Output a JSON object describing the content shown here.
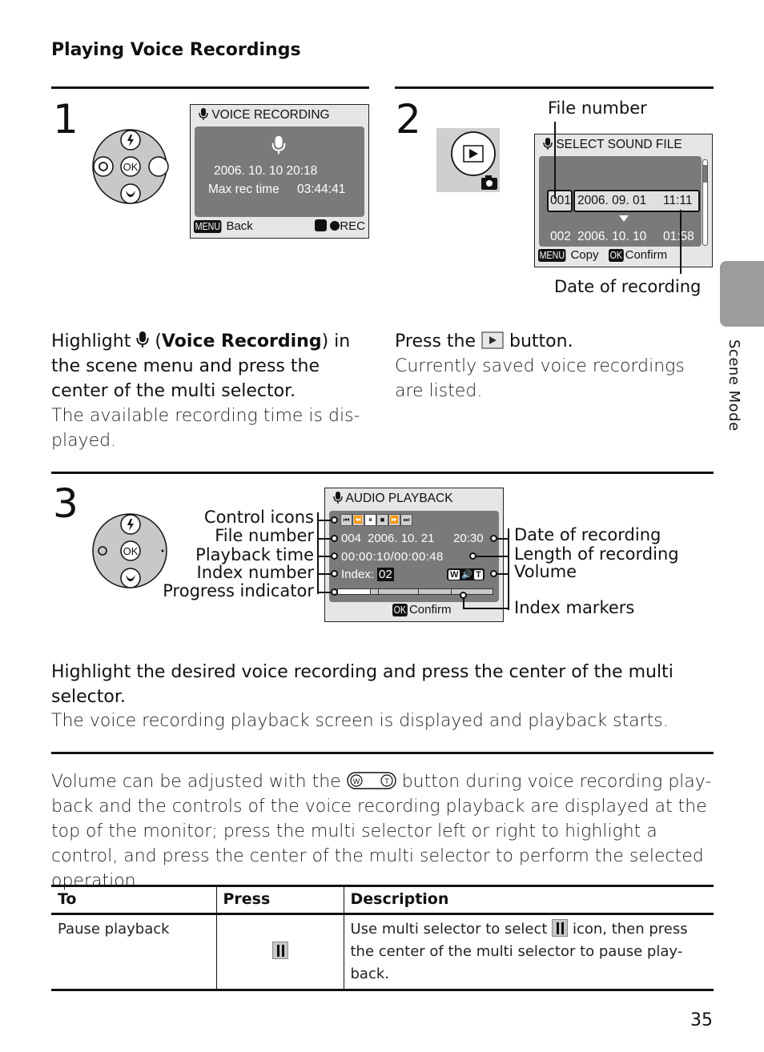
{
  "page": {
    "title": "Playing Voice Recordings",
    "page_number": "35",
    "side_tab_label": "Scene Mode"
  },
  "step1": {
    "number": "1",
    "screen": {
      "header": "VOICE RECORDING",
      "date_time": "2006. 10. 10   20:18",
      "max_rec_label": "Max rec time",
      "max_rec_value": "03:44:41",
      "menu_badge": "MENU",
      "back_label": "Back",
      "rec_label": "REC"
    },
    "instruction_pre": "Highlight",
    "instruction_bold": "Voice Recording",
    "instruction_post": ") in the scene menu and press the center of the multi selector.",
    "instruction_open_paren": "(",
    "description": "The available recording time is dis-played."
  },
  "step2": {
    "number": "2",
    "callout_file_number": "File number",
    "callout_date": "Date of recording",
    "screen": {
      "header": "SELECT SOUND FILE",
      "rows": [
        {
          "file": "001",
          "date": "2006. 09. 01",
          "time": "11:11",
          "selected": true
        },
        {
          "file": "002",
          "date": "2006. 10. 10",
          "time": "01:58",
          "selected": false
        }
      ],
      "menu_badge": "MENU",
      "copy_label": "Copy",
      "ok_badge": "OK",
      "confirm_label": "Confirm"
    },
    "instruction_pre": "Press the",
    "instruction_post": "button.",
    "description": "Currently saved voice recordings are listed."
  },
  "step3": {
    "number": "3",
    "screen": {
      "header": "AUDIO PLAYBACK",
      "controls": [
        "skip-back",
        "rewind",
        "pause",
        "stop",
        "fast-forward",
        "skip-forward"
      ],
      "selected_control": "pause",
      "file_number": "004",
      "date": "2006. 10. 21",
      "time": "20:30",
      "playback_time": "00:00:10/00:00:48",
      "index_label": "Index:",
      "index_value": "02",
      "volume_w": "W",
      "volume_t": "T",
      "progress_fraction": 0.208,
      "index_marker_fractions": [
        0.208,
        0.26,
        0.52,
        0.73
      ],
      "ok_badge": "OK",
      "confirm_label": "Confirm"
    },
    "callouts_left": [
      "Control icons",
      "File number",
      "Playback time",
      "Index number",
      "Progress indicator"
    ],
    "callouts_right": [
      "Date of recording",
      "Length of recording",
      "Volume",
      "Index markers"
    ],
    "instruction": "Highlight the desired voice recording and press the center of the multi selector.",
    "description": "The voice recording playback screen is displayed and playback starts."
  },
  "note": {
    "pre": "Volume can be adjusted with the",
    "post": "button during voice recording play-back and the controls of the voice recording playback are displayed at the top of the monitor; press the multi selector left or right to highlight a control, and press the center of the multi selector to perform the selected operation.",
    "button_w": "W",
    "button_t": "T"
  },
  "table": {
    "headers": [
      "To",
      "Press",
      "Description"
    ],
    "rows": [
      {
        "to": "Pause playback",
        "press_icon": "pause-icon",
        "desc_pre": "Use multi selector to select",
        "desc_post": "icon, then press the center of the multi selector to pause play-back."
      }
    ]
  },
  "selector": {
    "center_label": "OK"
  }
}
